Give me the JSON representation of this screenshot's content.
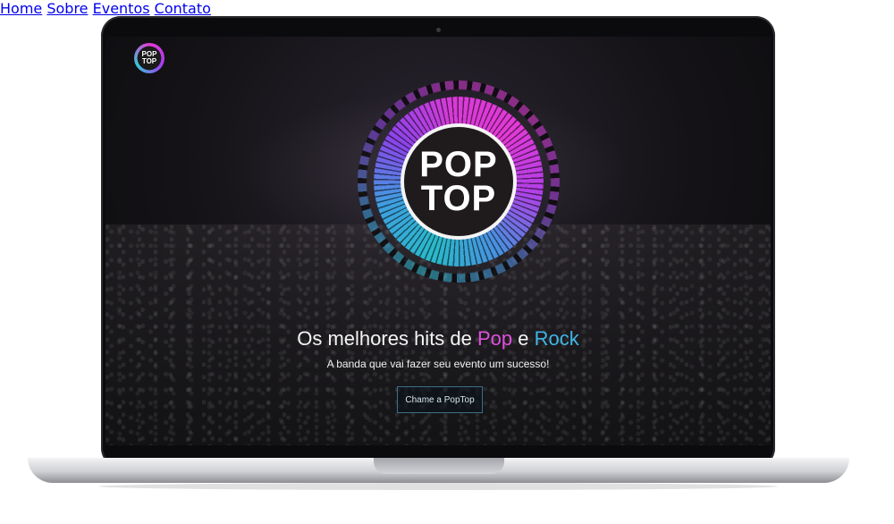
{
  "brand": {
    "logo_line1": "POP",
    "logo_line2": "TOP"
  },
  "nav": {
    "items": [
      {
        "label": "Home"
      },
      {
        "label": "Sobre"
      },
      {
        "label": "Eventos"
      },
      {
        "label": "Contato"
      }
    ]
  },
  "hero": {
    "logo_line1": "POP",
    "logo_line2": "TOP",
    "headline_prefix": "Os melhores hits de ",
    "headline_pop": "Pop",
    "headline_mid": " e ",
    "headline_rock": "Rock",
    "subline": "A banda que vai fazer seu evento um sucesso!",
    "cta_label": "Chame a PopTop"
  },
  "colors": {
    "pop_accent": "#e04fe0",
    "rock_accent": "#3fb6e6",
    "background": "#141216"
  }
}
